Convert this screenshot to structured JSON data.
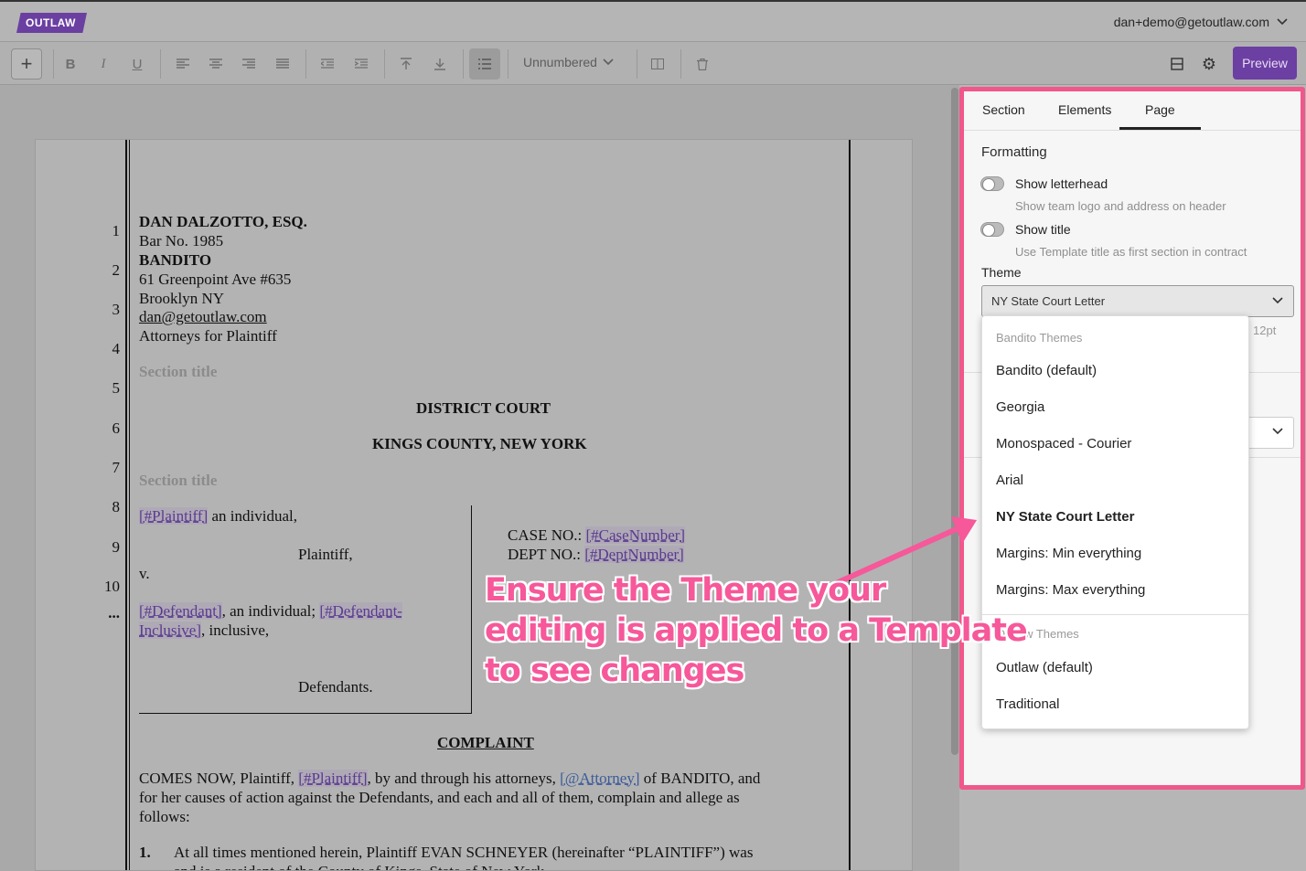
{
  "app": {
    "logo": "OUTLAW",
    "user_email": "dan+demo@getoutlaw.com"
  },
  "toolbar": {
    "numbering_label": "Unnumbered",
    "preview_label": "Preview"
  },
  "document": {
    "line_numbers": [
      "1",
      "2",
      "3",
      "4",
      "5",
      "6",
      "7",
      "8",
      "9",
      "10",
      "..."
    ],
    "attorney_name": "DAN DALZOTTO, ESQ.",
    "bar_no": "Bar No. 1985",
    "firm": "BANDITO",
    "address1": "61 Greenpoint Ave #635",
    "address2": "Brooklyn NY",
    "email": "dan@getoutlaw.com",
    "attorneys_for": "Attorneys for Plaintiff",
    "section_title_placeholder": "Section title",
    "court": "DISTRICT COURT",
    "county": "KINGS COUNTY, NEW YORK",
    "plaintiff_tag": "[#Plaintiff]",
    "plaintiff_suffix": " an individual,",
    "plaintiff_role": "Plaintiff,",
    "versus": "v.",
    "defendant_tag": "[#Defendant]",
    "defendant_suffix": ", an individual; ",
    "defendant_inclusive_tag_1": "[#Defendant-",
    "defendant_inclusive_tag_2": "Inclusive]",
    "inclusive_suffix": ", inclusive,",
    "defendants_role": "Defendants.",
    "case_no_label": "CASE NO.: ",
    "case_no_tag": "[#CaseNumber]",
    "dept_no_label": "DEPT NO.: ",
    "dept_no_tag": "[#DeptNumber]",
    "complaint_heading": "COMPLAINT",
    "comes_now_1": "COMES NOW, Plaintiff, ",
    "comes_now_plaintiff_tag": "[#Plaintiff]",
    "comes_now_2": ", by and through his attorneys, ",
    "attorney_tag": "[@Attorney]",
    "comes_now_3": "  of BANDITO, and",
    "comes_now_line2": "for her causes of action against the Defendants, and each and all of them, complain and allege as",
    "comes_now_line3": "follows:",
    "item1_num": "1.",
    "item1_line1": "At all times mentioned herein, Plaintiff EVAN SCHNEYER (hereinafter “PLAINTIFF”) was",
    "item1_line2": "and is a resident of the County of Kings, State of New York."
  },
  "panel": {
    "tabs": [
      {
        "label": "Section"
      },
      {
        "label": "Elements"
      },
      {
        "label": "Page"
      }
    ],
    "active_tab": "Page",
    "formatting_heading": "Formatting",
    "show_letterhead_label": "Show letterhead",
    "show_letterhead_desc": "Show team logo and address on header",
    "show_title_label": "Show title",
    "show_title_desc": "Use Template title as first section in contract",
    "theme_label": "Theme",
    "theme_value": "NY State Court Letter",
    "font_size_hint": "12pt"
  },
  "theme_dropdown": {
    "group1_label": "Bandito Themes",
    "group1_items": [
      "Bandito (default)",
      "Georgia",
      "Monospaced - Courier",
      "Arial",
      "NY State Court Letter",
      "Margins: Min everything",
      "Margins: Max everything"
    ],
    "selected": "NY State Court Letter",
    "group2_label": "Outlaw Themes",
    "group2_items": [
      "Outlaw (default)",
      "Traditional"
    ]
  },
  "annotation": {
    "line1": "Ensure the Theme your",
    "line2": "editing is applied to a Template",
    "line3": "to see changes",
    "color": "#f6589a"
  },
  "colors": {
    "accent": "#6c3fa3",
    "highlight_border": "#f0578b"
  }
}
